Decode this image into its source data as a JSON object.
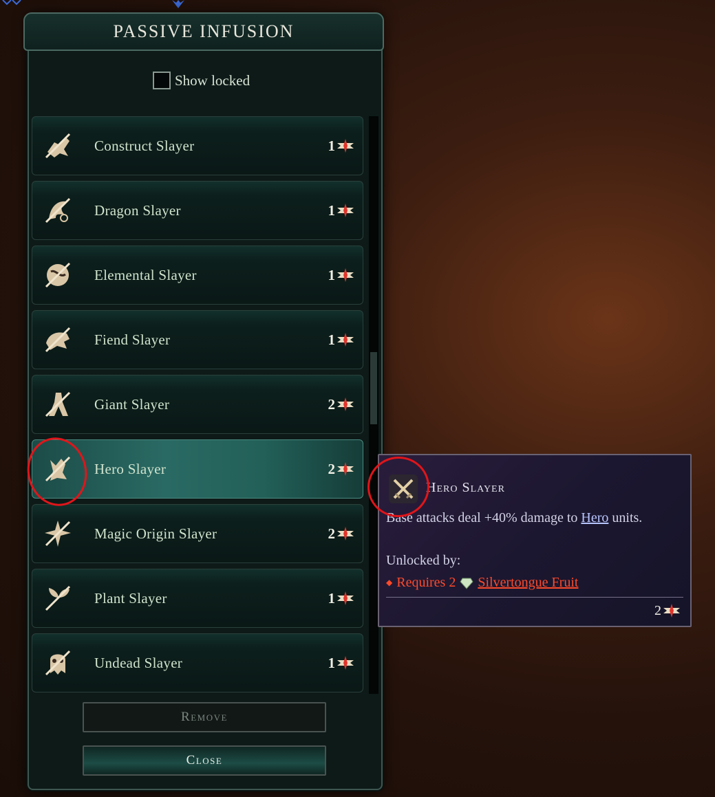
{
  "window": {
    "title": "PASSIVE INFUSION"
  },
  "filters": {
    "show_locked_label": "Show locked",
    "show_locked_checked": false
  },
  "list": {
    "items": [
      {
        "label": "Construct Slayer",
        "cost": "1",
        "icon": "construct-slayer-icon"
      },
      {
        "label": "Dragon Slayer",
        "cost": "1",
        "icon": "dragon-slayer-icon"
      },
      {
        "label": "Elemental Slayer",
        "cost": "1",
        "icon": "elemental-slayer-icon"
      },
      {
        "label": "Fiend Slayer",
        "cost": "1",
        "icon": "fiend-slayer-icon"
      },
      {
        "label": "Giant Slayer",
        "cost": "2",
        "icon": "giant-slayer-icon"
      },
      {
        "label": "Hero Slayer",
        "cost": "2",
        "icon": "hero-slayer-icon",
        "selected": true
      },
      {
        "label": "Magic Origin Slayer",
        "cost": "2",
        "icon": "magic-origin-slayer-icon"
      },
      {
        "label": "Plant Slayer",
        "cost": "1",
        "icon": "plant-slayer-icon"
      },
      {
        "label": "Undead Slayer",
        "cost": "1",
        "icon": "undead-slayer-icon"
      }
    ]
  },
  "buttons": {
    "remove_label": "Remove",
    "close_label": "Close"
  },
  "tooltip": {
    "title": "Hero Slayer",
    "desc_prefix": "Base attacks deal +40% damage to ",
    "desc_link": "Hero",
    "desc_suffix": " units.",
    "unlocked_by_label": "Unlocked by:",
    "requirement_prefix": "Requires 2",
    "requirement_item": " Silvertongue Fruit",
    "cost": "2"
  },
  "colors": {
    "panel_bg": "#0d1a18",
    "row_selected": "#2a6a64",
    "tooltip_bg": "#1c1730",
    "requirement_red": "#ff4a2a",
    "annotation_red": "#e0151a"
  }
}
